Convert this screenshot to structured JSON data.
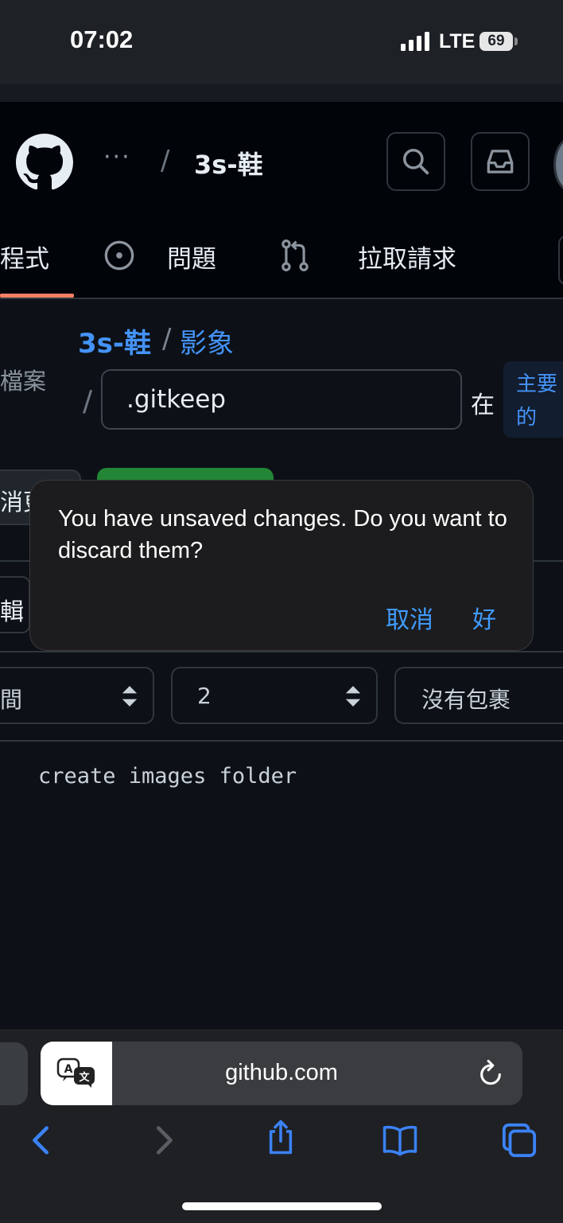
{
  "status_bar": {
    "time": "07:02",
    "network": "LTE",
    "battery": "69"
  },
  "header": {
    "ellipsis": "···",
    "separator": "/",
    "repo": "3s-鞋",
    "icons": [
      "github-logo",
      "search-icon",
      "inbox-icon"
    ]
  },
  "tabs": {
    "code": "程式",
    "issues": "問題",
    "pull_requests": "拉取請求"
  },
  "editor": {
    "crumb_repo": "3s-鞋",
    "crumb_sep": "/",
    "crumb_folder": "影象",
    "files_label": "檔案",
    "path_sep": "/",
    "filename_value": ".gitkeep",
    "in_label": "在",
    "branch": "主要的",
    "cancel_peek": "消更",
    "edit_tab_peek": "輯",
    "indent_mode": "間",
    "indent_size": "2",
    "wrap_mode": "沒有包裹",
    "code": "create images folder"
  },
  "dialog": {
    "message": "You have unsaved changes. Do you want to discard them?",
    "cancel": "取消",
    "ok": "好"
  },
  "safari": {
    "url": "github.com",
    "icons": [
      "translate-icon",
      "reload-icon",
      "back-icon",
      "forward-icon",
      "share-icon",
      "bookmarks-icon",
      "tabs-icon"
    ]
  },
  "colors": {
    "accent": "#4493f8",
    "dialog_button": "#409cff",
    "tab_underline": "#f78166",
    "primary_button": "#238636"
  }
}
